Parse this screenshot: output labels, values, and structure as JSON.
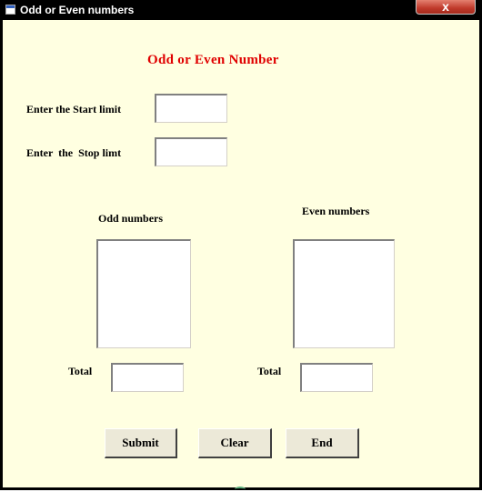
{
  "window": {
    "title": "Odd or Even numbers",
    "close_label": "x",
    "icon": "app-window-icon"
  },
  "form": {
    "heading": "Odd or Even Number",
    "start_label": "Enter the Start limit",
    "stop_label": "Enter  the  Stop limt",
    "start_value": "",
    "stop_value": "",
    "odd_label": "Odd numbers",
    "even_label": "Even numbers",
    "odd_total_label": "Total",
    "even_total_label": "Total",
    "odd_total_value": "",
    "even_total_value": ""
  },
  "buttons": {
    "submit": "Submit",
    "clear": "Clear",
    "end": "End"
  },
  "colors": {
    "background": "#ffffe1",
    "heading": "#e00000",
    "titlebar": "#000000"
  }
}
